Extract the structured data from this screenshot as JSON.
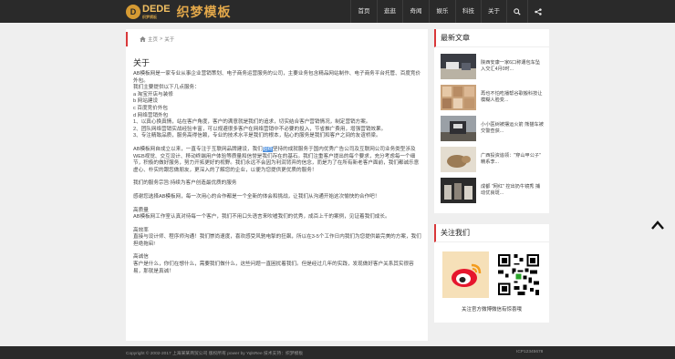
{
  "header": {
    "logo_mark": "D",
    "logo_en": "DEDE",
    "logo_sub": "织梦模板",
    "logo_cn": "织梦模板"
  },
  "nav": {
    "items": [
      "首页",
      "逛逛",
      "奇闻",
      "娱乐",
      "科技",
      "关于"
    ],
    "search_icon": "search-icon",
    "share_icon": "share-icon"
  },
  "breadcrumb": {
    "home_icon": "home-icon",
    "home": "主页",
    "separator": ">",
    "current": "关于"
  },
  "article": {
    "title": "关于",
    "p1": "AB模板网是一家专业从事企业营销策划、电子商务运营服务的公司，主要业务包含精品网站制作、电子商务平台托管、百度竞价外包。",
    "p2": "我们主要提供以下几点服务：",
    "list": [
      "a 淘宝开店与装修",
      "b 网站建设",
      "c 百度竞价外包",
      "d 网络营销外包"
    ],
    "n1": "1、以真心换真情，站在客户角度，客户的满意就是我们的追求，切实结合客户营销情况，制定营销方案。",
    "n2": "2、团队网络营销实战经验丰富，可以规避很多客户在网络营销中不必要的投入，节省推广费用，增强营销效果。",
    "n3": "3、专注精致品质，服务高得信赖，专业的技术水平是我们的根本，贴心的服务是我们和客户之间的友谊桥梁。",
    "p3a": "AB模板网自成立以来，一直专注于互联网品牌建设，我们",
    "p3hl": "始终",
    "p3b": "坚持的成就服务于国内优秀广告公司及互联网公司业务类型涉及WEB视觉、交互设计、移动终端用户体验等质量和信誉是我们存在的基石。我们注重客户提出的每个要求，充分考虑每一个细节，积极的做好服务，努力开拓更好的视野。我们永远不会因为利润背弃的信念，而是为了在所有新老客户面前，我们都诚乐意虚心、朴实的跟您做朋友，更深入的了解您的企业，以便为您提供更优质的服务！",
    "p4": "我们的服务宗旨:持续为客户创造最优质的服务",
    "p5": "感谢您选择AB模板网，每一次用心的合作都是一个全新的体会和挑战，让我们从沟通开始这次愉快的合作吧！",
    "s1_title": "高质量",
    "s1_body": "AB模板网工作室认真对待每一个客户，我们不用口头语言来吹嘘我们的优秀，成百上千的案例，见证着我们成长。",
    "s2_title": "高效率",
    "s2_body": "直接与设计师、程序师沟通！我们崇尚速度，喜欢感受风驰电掣的狂飙，所以在3-5个工作日内我们为您提供最完美的方案，我们担绝拖宕!",
    "s3_title": "高诚信",
    "s3_body": "客户是什么，你们在想什么，需要我们做什么，这些问题一直困扰着我们。但是经过几年的实践，发现做好客户关系其实很容易，那就是真诚！"
  },
  "sidebar": {
    "news_title": "最新文章",
    "news": [
      {
        "title": "陕西安康一家6口称遭包车坠入交汇4月0时..."
      },
      {
        "title": "再也不怕吃播帮谷歌搬科技让模糊人脸变..."
      },
      {
        "title": "小小医树被摆运火箭 熊猫车被交警查获..."
      },
      {
        "title": "广西投资追领：\"穿山甲公子\" 精系李..."
      },
      {
        "title": "成都 \"网红\" 控出奶牛镜秀 捕动优良斑..."
      }
    ],
    "follow_title": "关注我们",
    "weibo_icon": "weibo-icon",
    "follow_caption": "关注官方微博微信有惊喜哦"
  },
  "back_to_top": "chevron-up-icon",
  "footer": {
    "left": "Copyright © 2002-2017 上海某某商贸公司 版权所有 power by YqlsRee    技术支持：织梦模板",
    "right": "ICP12345678"
  },
  "colors": {
    "topbar": "#2a2a2a",
    "accent": "#d9383a",
    "logo": "#e3a84a",
    "highlight": "#4a8fe0"
  }
}
